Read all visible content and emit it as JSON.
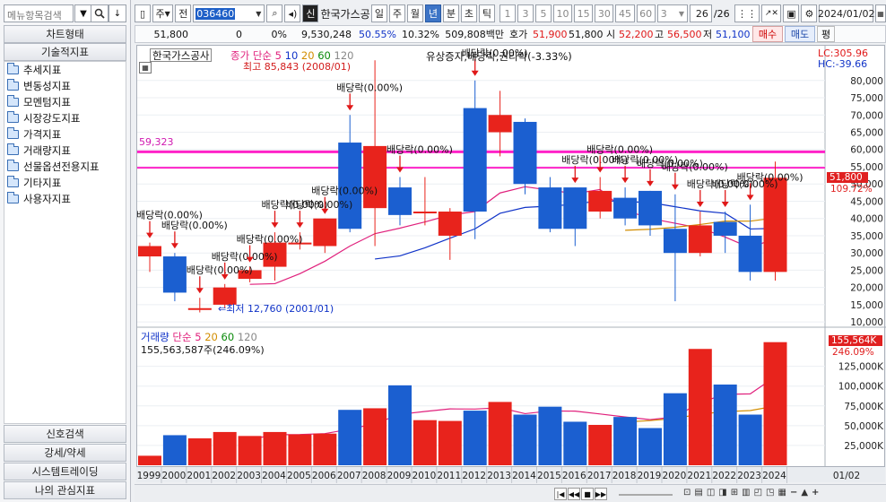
{
  "left_panel": {
    "search_placeholder": "메뉴항목검색",
    "chart_type_header": "차트형태",
    "tech_header": "기술적지표",
    "indicator_folders": [
      "추세지표",
      "변동성지표",
      "모멘텀지표",
      "시장강도지표",
      "가격지표",
      "거래량지표",
      "선물옵션전용지표",
      "기타지표",
      "사용자지표"
    ],
    "bottom_buttons": [
      "신호검색",
      "강세/약세",
      "시스템트레이딩",
      "나의 관심지표"
    ]
  },
  "toolbar": {
    "period_label": "주",
    "prev_label": "전",
    "stock_code": "036460",
    "stock_name": "한국가스공",
    "period_tabs": [
      "일",
      "주",
      "월",
      "년",
      "분",
      "초",
      "틱"
    ],
    "active_period": "년",
    "intervals": [
      "1",
      "3",
      "5",
      "10",
      "15",
      "30",
      "45",
      "60"
    ],
    "interval_select": "3",
    "page_count": "26",
    "page_total": "/26",
    "date": "2024/01/02"
  },
  "quote_bar": {
    "price": "51,800",
    "change": "0",
    "change_pct": "0%",
    "volume": "9,530,248",
    "vol_rate": "50.55%",
    "turnover": "10.32%",
    "amount": "509,808백만",
    "hoga_label": "호가",
    "hoga_price": "51,900",
    "hoga_price2": "51,800",
    "open_label": "시",
    "open": "52,200",
    "high_label": "고",
    "high": "56,500",
    "low_label": "저",
    "low": "51,100",
    "buy_label": "매수",
    "sell_label": "매도",
    "eval_label": "평"
  },
  "price_panel": {
    "stock_label": "한국가스공사",
    "ma_label": "종가 단순",
    "ma_periods": [
      "5",
      "10",
      "20",
      "60",
      "120"
    ],
    "lc_label": "LC:305.96",
    "hc_label": "HC:-39.66",
    "max_label": "최고 85,843 (2008/01)",
    "min_label": "최저 12,760 (2001/01)",
    "hline_label": "59,323",
    "current_price_tag": "51,800",
    "current_pct_tag": "109.72%",
    "rights_label": "유상증자,배당락,권리락(-3.33%)",
    "dividend_label": "배당락(0.00%)",
    "y_ticks": [
      "80,000",
      "75,000",
      "70,000",
      "65,000",
      "60,000",
      "55,000",
      "50,000",
      "45,000",
      "40,000",
      "35,000",
      "30,000",
      "25,000",
      "20,000",
      "15,000",
      "10,000"
    ]
  },
  "volume_panel": {
    "label": "거래량",
    "ma_label": "단순",
    "ma_periods": [
      "5",
      "20",
      "60",
      "120"
    ],
    "info": "155,563,587주(246.09%)",
    "current_tag": "155,564K",
    "current_pct_tag": "246.09%",
    "y_ticks": [
      "125,000K",
      "100,000K",
      "75,000K",
      "50,000K",
      "25,000K"
    ]
  },
  "x_axis": {
    "years": [
      "1999",
      "2000",
      "2001",
      "2002",
      "2003",
      "2004",
      "2005",
      "2006",
      "2007",
      "2008",
      "2009",
      "2010",
      "2011",
      "2012",
      "2013",
      "2014",
      "2015",
      "2016",
      "2017",
      "2018",
      "2019",
      "2020",
      "2021",
      "2022",
      "2023",
      "2024"
    ],
    "right_label": "01/02"
  },
  "chart_data": {
    "type": "candlestick",
    "x": [
      "1999",
      "2000",
      "2001",
      "2002",
      "2003",
      "2004",
      "2005",
      "2006",
      "2007",
      "2008",
      "2009",
      "2010",
      "2011",
      "2012",
      "2013",
      "2014",
      "2015",
      "2016",
      "2017",
      "2018",
      "2019",
      "2020",
      "2021",
      "2022",
      "2023",
      "2024"
    ],
    "open": [
      29000,
      29000,
      14000,
      20000,
      22500,
      26000,
      33000,
      40000,
      62000,
      61000,
      49000,
      42000,
      35000,
      72000,
      65000,
      68000,
      49000,
      49000,
      42000,
      46000,
      48000,
      37000,
      38000,
      39000,
      35000,
      24500
    ],
    "close": [
      32000,
      18500,
      14000,
      15000,
      25000,
      33000,
      33000,
      32000,
      37000,
      43000,
      41000,
      42000,
      42000,
      42000,
      70000,
      50000,
      37000,
      37000,
      48000,
      40000,
      38000,
      30000,
      30000,
      35000,
      24500,
      51800
    ],
    "high": [
      33000,
      30000,
      17000,
      21000,
      26000,
      36000,
      36000,
      40000,
      70000,
      85843,
      52000,
      52000,
      43000,
      80000,
      77000,
      69000,
      52000,
      49000,
      52000,
      49000,
      48000,
      47000,
      42000,
      42000,
      44000,
      56500
    ],
    "low": [
      24500,
      16000,
      12760,
      14000,
      21500,
      22000,
      31000,
      30000,
      36000,
      32000,
      38000,
      38000,
      28000,
      34000,
      58000,
      47000,
      36000,
      32000,
      40000,
      38000,
      35000,
      16000,
      29000,
      30000,
      22000,
      22000
    ],
    "direction": [
      "up",
      "down",
      "flat",
      "up",
      "up",
      "up",
      "up",
      "up",
      "down",
      "up",
      "down",
      "flat",
      "up",
      "down",
      "up",
      "down",
      "down",
      "down",
      "up",
      "down",
      "down",
      "down",
      "up",
      "down",
      "down",
      "up"
    ],
    "up_color": "#e8231c",
    "down_color": "#1b5fd0",
    "volume": [
      12000,
      38000,
      34000,
      42000,
      37000,
      42000,
      39000,
      40000,
      70000,
      72000,
      101000,
      57000,
      56000,
      69000,
      80000,
      64000,
      74000,
      55000,
      51000,
      61000,
      47000,
      91000,
      147000,
      102000,
      64000,
      155564
    ],
    "y_range": [
      9000,
      88000
    ],
    "volume_range": [
      0,
      162000
    ]
  },
  "colors": {
    "hline": "#ff22c8",
    "up": "#e8231c",
    "down": "#1b5fd0",
    "accent_blue": "#1033c8"
  }
}
